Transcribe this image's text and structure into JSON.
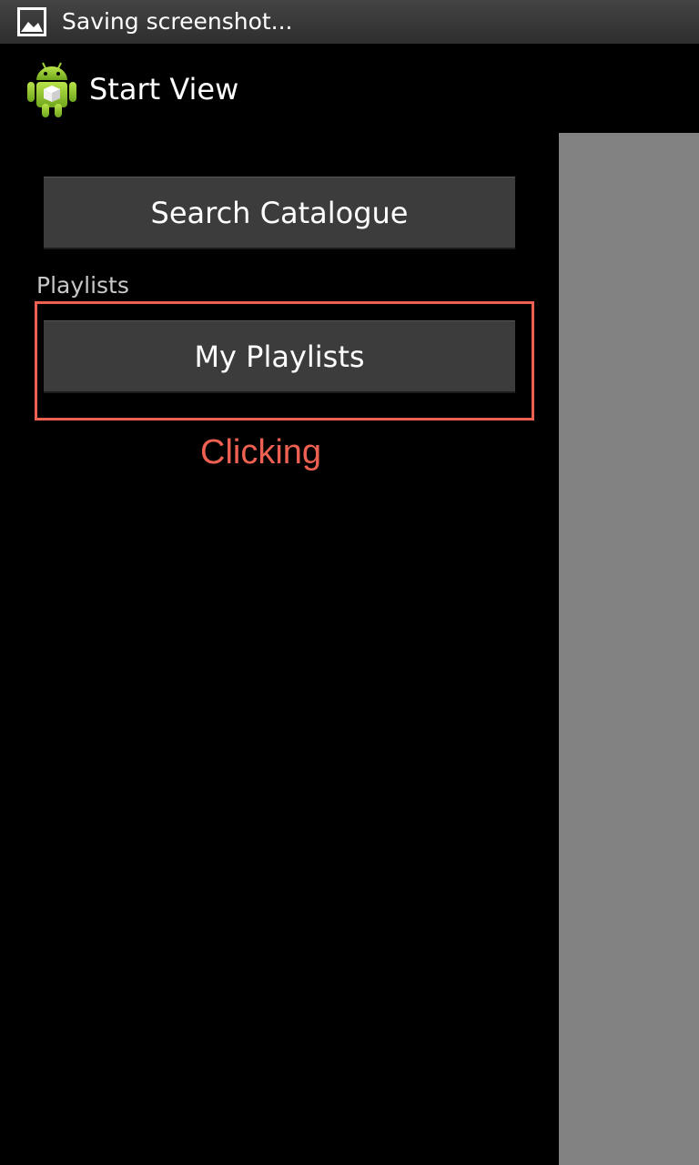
{
  "status_bar": {
    "notification_icon": "image-icon",
    "text": "Saving screenshot..."
  },
  "action_bar": {
    "app_icon": "android-robot-icon",
    "title": "Start View"
  },
  "main": {
    "search_button_label": "Search Catalogue",
    "playlists_section_label": "Playlists",
    "my_playlists_button_label": "My Playlists"
  },
  "annotation": {
    "text": "Clicking",
    "color": "#ee6152"
  },
  "colors": {
    "background": "#000000",
    "button": "#3c3c3c",
    "side_panel": "#828282"
  }
}
